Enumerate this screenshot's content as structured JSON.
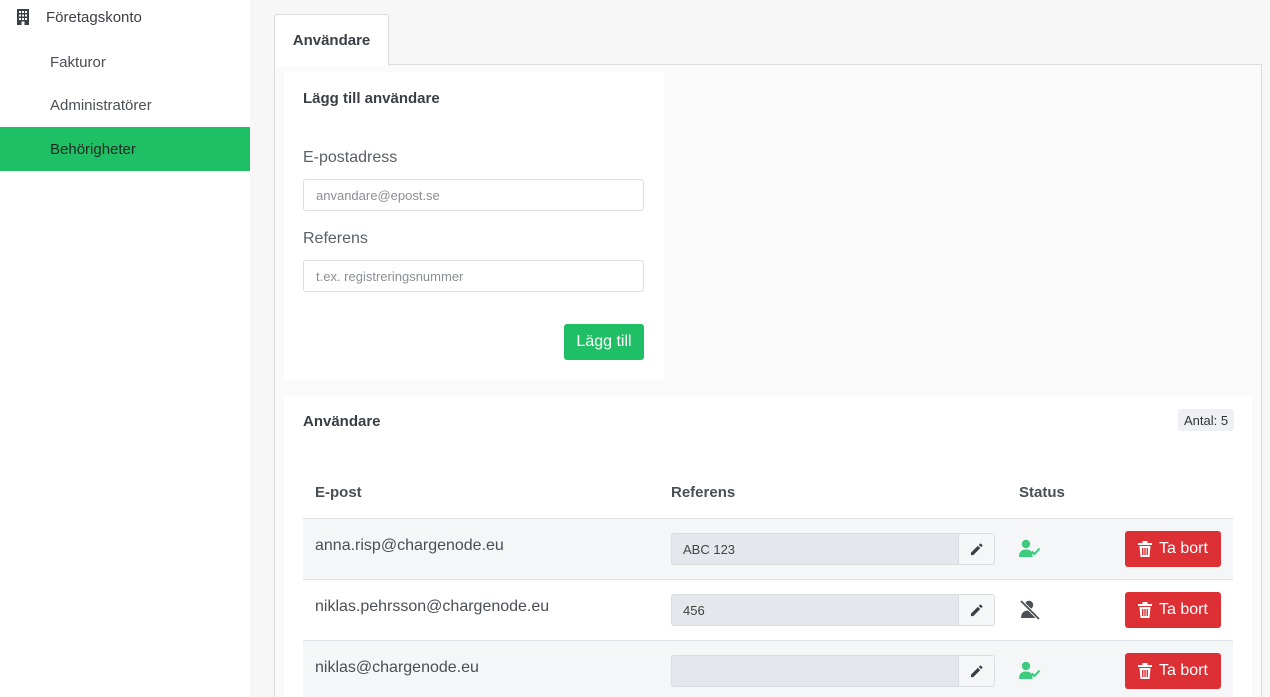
{
  "sidebar": {
    "header": "Företagskonto",
    "items": [
      {
        "label": "Fakturor",
        "active": false
      },
      {
        "label": "Administratörer",
        "active": false
      },
      {
        "label": "Behörigheter",
        "active": true
      }
    ]
  },
  "tabs": [
    {
      "label": "Användare",
      "active": true
    }
  ],
  "add_user": {
    "title": "Lägg till användare",
    "email_label": "E-postadress",
    "email_placeholder": "anvandare@epost.se",
    "reference_label": "Referens",
    "reference_placeholder": "t.ex. registreringsnummer",
    "submit_label": "Lägg till"
  },
  "users": {
    "title": "Användare",
    "count_label": "Antal: 5",
    "columns": [
      "E-post",
      "Referens",
      "Status"
    ],
    "delete_label": "Ta bort",
    "rows": [
      {
        "email": "anna.risp@chargenode.eu",
        "reference": "ABC 123",
        "status": "active"
      },
      {
        "email": "niklas.pehrsson@chargenode.eu",
        "reference": "456",
        "status": "inactive"
      },
      {
        "email": "niklas@chargenode.eu",
        "reference": "",
        "status": "active"
      }
    ]
  },
  "colors": {
    "accent": "#1fbf65",
    "danger": "#dc3035",
    "status_active": "#3ccb7f",
    "status_inactive": "#4a4f55"
  },
  "icons": {
    "sidebar_header": "building-icon",
    "edit": "pencil-icon",
    "status_active": "user-check-icon",
    "status_inactive": "user-slash-icon",
    "delete": "trash-icon"
  }
}
